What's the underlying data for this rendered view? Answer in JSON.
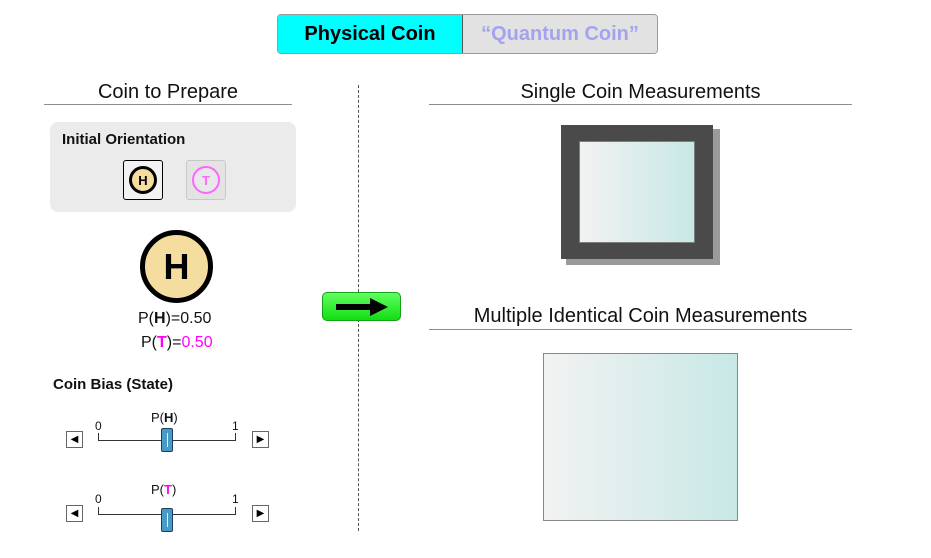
{
  "toggle": {
    "physical_label": "Physical Coin",
    "quantum_label": "“Quantum Coin”"
  },
  "left": {
    "heading": "Coin to Prepare",
    "orientation": {
      "title": "Initial Orientation",
      "heads_glyph": "H",
      "tails_glyph": "T",
      "selected": "H"
    },
    "coin": {
      "face": "H"
    },
    "prob_heads": {
      "prefix": "P(",
      "symbol": "H",
      "suffix": ")=",
      "value": "0.50"
    },
    "prob_tails": {
      "prefix": "P(",
      "symbol": "T",
      "suffix": ")=",
      "value": "0.50"
    },
    "bias": {
      "title": "Coin Bias (State)",
      "sliders": [
        {
          "prefix": "P(",
          "symbol": "H",
          "suffix": ")",
          "min_label": "0",
          "max_label": "1",
          "value": 0.5
        },
        {
          "prefix": "P(",
          "symbol": "T",
          "suffix": ")",
          "min_label": "0",
          "max_label": "1",
          "value": 0.5
        }
      ],
      "left_arrow": "◀",
      "right_arrow": "▶"
    }
  },
  "right": {
    "single_heading": "Single Coin Measurements",
    "multiple_heading": "Multiple Identical Coin Measurements"
  },
  "colors": {
    "toggle_selected": "#00ffff",
    "tails": "#ff00ff",
    "coin_fill": "#f5dda0",
    "thumb": "#4a9ac8",
    "go_button": "#2ee82e"
  },
  "icons": {
    "measure_button": "right-arrow-icon"
  }
}
